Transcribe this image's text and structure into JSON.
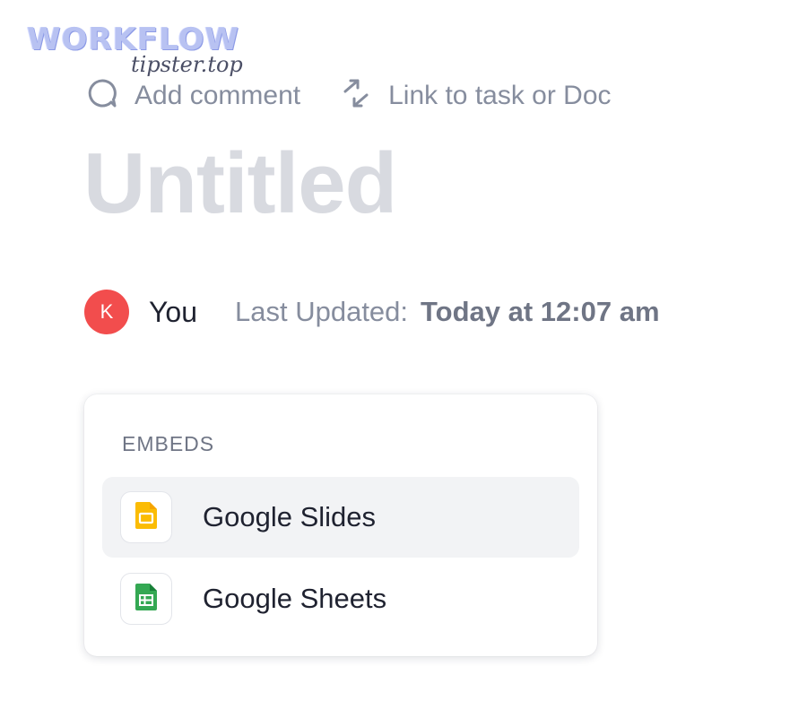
{
  "watermark": {
    "logo": "WORKFLOW",
    "subtitle": "tipster.top"
  },
  "toolbar": {
    "add_comment": {
      "label": "Add comment",
      "icon": "comment-icon"
    },
    "link_task": {
      "label": "Link to task or Doc",
      "icon": "link-arrows-icon"
    }
  },
  "doc": {
    "title": "Untitled"
  },
  "meta": {
    "avatar_initial": "K",
    "avatar_color": "#f24d4d",
    "author": "You",
    "last_updated_label": "Last Updated:",
    "last_updated_value": "Today at 12:07 am"
  },
  "embeds": {
    "header": "EMBEDS",
    "items": [
      {
        "label": "Google Slides",
        "icon": "google-slides-icon",
        "color": "#fbbc04",
        "highlighted": true
      },
      {
        "label": "Google Sheets",
        "icon": "google-sheets-icon",
        "color": "#34a853",
        "highlighted": false
      }
    ]
  }
}
